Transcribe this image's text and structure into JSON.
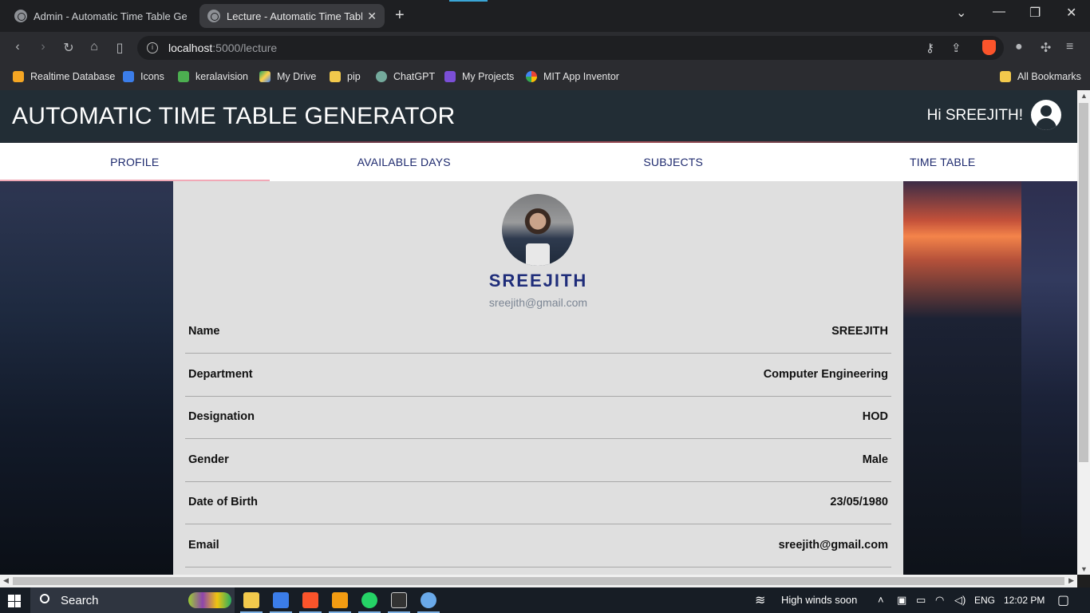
{
  "browser": {
    "tabs": [
      {
        "title": "Admin - Automatic Time Table Generator"
      },
      {
        "title": "Lecture - Automatic Time Table Generator"
      }
    ],
    "url_host": "localhost",
    "url_rest": ":5000/lecture",
    "bookmarks": [
      "Realtime Database",
      "Icons",
      "keralavision",
      "My Drive",
      "pip",
      "ChatGPT",
      "My Projects",
      "MIT App Inventor"
    ],
    "all_bookmarks": "All Bookmarks"
  },
  "app": {
    "title": "AUTOMATIC TIME TABLE GENERATOR",
    "greeting": "Hi SREEJITH!"
  },
  "nav": {
    "tabs": [
      "PROFILE",
      "AVAILABLE DAYS",
      "SUBJECTS",
      "TIME TABLE"
    ],
    "active": "PROFILE"
  },
  "profile": {
    "name": "SREEJITH",
    "email": "sreejith@gmail.com",
    "fields": [
      {
        "label": "Name",
        "value": "SREEJITH"
      },
      {
        "label": "Department",
        "value": "Computer Engineering"
      },
      {
        "label": "Designation",
        "value": "HOD"
      },
      {
        "label": "Gender",
        "value": "Male"
      },
      {
        "label": "Date of Birth",
        "value": "23/05/1980"
      },
      {
        "label": "Email",
        "value": "sreejith@gmail.com"
      }
    ]
  },
  "taskbar": {
    "search_label": "Search",
    "weather": "High winds soon",
    "language": "ENG",
    "time": "12:02 PM"
  }
}
